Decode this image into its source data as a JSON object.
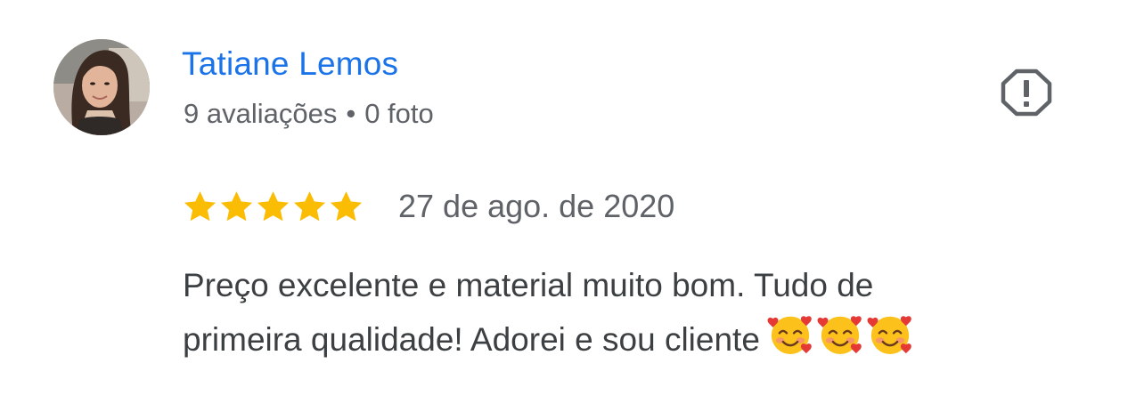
{
  "review": {
    "author": {
      "name": "Tatiane Lemos",
      "reviews_count": "9 avaliações",
      "separator": "•",
      "photos_count": "0 foto"
    },
    "report_icon": "report-flag-icon",
    "rating": {
      "stars": 5,
      "max_stars": 5,
      "star_color": "#fbbc04"
    },
    "date": "27 de ago. de 2020",
    "text": {
      "line1": "Preço excelente e material muito bom. Tudo de",
      "line2": "primeira qualidade! Adorei e sou cliente",
      "emoji_icon": "smiling-face-with-hearts-icon",
      "emoji_count": 3
    },
    "colors": {
      "name": "#1a73e8",
      "meta": "#5f6368",
      "body": "#3c4043"
    }
  }
}
